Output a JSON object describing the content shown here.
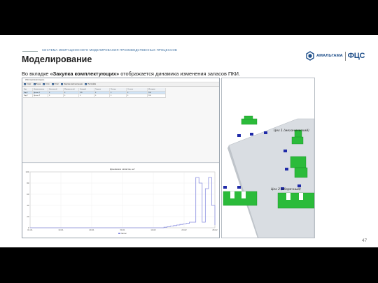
{
  "slide": {
    "kicker": "СИСТЕМА ИМИТАЦИОННОГО МОДЕЛИРОВАНИЯ ПРОИЗВОДСТВЕННЫХ ПРОЦЕССОВ",
    "title": "Моделирование",
    "caption_pre": "Во вкладке ",
    "caption_bold": "«Закупка комплектующих»",
    "caption_post": " отображается динамика изменения запасов ПКИ.",
    "page_number": "47"
  },
  "logo": {
    "brand": "АМАЛЬГАМА",
    "product": "ФЦС",
    "colors": {
      "primary": "#1f4f8a"
    }
  },
  "app": {
    "window_title": "Имитационная модель",
    "toolbar": [
      {
        "icon": "play-icon",
        "label": "Старт"
      },
      {
        "icon": "pause-icon",
        "label": "Пауза"
      },
      {
        "icon": "stop-icon",
        "label": "Стоп"
      },
      {
        "icon": "chart-icon",
        "label": "Отчёт"
      },
      {
        "icon": "table-icon",
        "label": "Закупка комплектующих"
      },
      {
        "icon": "settings-icon",
        "label": "Настройки"
      }
    ],
    "grid": {
      "columns": [
        "Код",
        "Наименование",
        "Начальный",
        "Минимальный",
        "Средний",
        "Закупки",
        "Расход",
        "Остаток",
        "Интервал"
      ],
      "rows": [
        [
          "Изд.1",
          "Деталь 1",
          "0",
          "0",
          "120",
          "0",
          "0",
          "0",
          "100"
        ],
        [
          "Изд.2",
          "Деталь 2",
          "0",
          "0",
          "0",
          "0",
          "0",
          "0",
          "100"
        ]
      ]
    }
  },
  "chart_data": {
    "type": "line",
    "title": "Динамика запасов, шт",
    "x_tick_labels": [
      "01.01",
      "10.01",
      "20.01",
      "30.01",
      "10.02",
      "20.02",
      "28.02"
    ],
    "ylim": [
      0,
      100
    ],
    "y_tick_labels": [
      "0",
      "20",
      "40",
      "60",
      "80",
      "100"
    ],
    "grid": true,
    "legend_placement": "bottom-center",
    "series": [
      {
        "name": "Запас",
        "color": "#8a8fe0",
        "x": [
          0,
          1,
          2,
          3,
          4,
          5,
          6,
          7,
          8,
          9,
          10,
          11,
          12,
          13,
          14,
          15,
          16,
          17,
          18,
          19,
          20,
          21,
          22,
          23,
          24,
          25,
          26,
          27,
          28,
          29,
          30,
          31,
          32,
          33,
          34,
          35,
          36,
          37,
          38,
          39,
          40,
          41,
          42,
          43,
          44,
          45,
          46,
          47,
          48,
          49,
          50,
          51,
          52,
          53,
          54,
          55,
          56,
          57,
          58
        ],
        "values": [
          0,
          0,
          0,
          0,
          0,
          0,
          0,
          0,
          0,
          0,
          0,
          0,
          0,
          0,
          0,
          0,
          0,
          0,
          0,
          0,
          0,
          0,
          0,
          0,
          0,
          0,
          0,
          0,
          0,
          0,
          0,
          0,
          0,
          0,
          0,
          0,
          0,
          0,
          0,
          0,
          0,
          0,
          1,
          2,
          3,
          4,
          5,
          6,
          7,
          8,
          10,
          10,
          90,
          80,
          10,
          70,
          90,
          40,
          5
        ]
      }
    ]
  },
  "view3d": {
    "label_1": "Цех 1 (механический)",
    "label_2": "Цех 2 (сборочный)"
  }
}
